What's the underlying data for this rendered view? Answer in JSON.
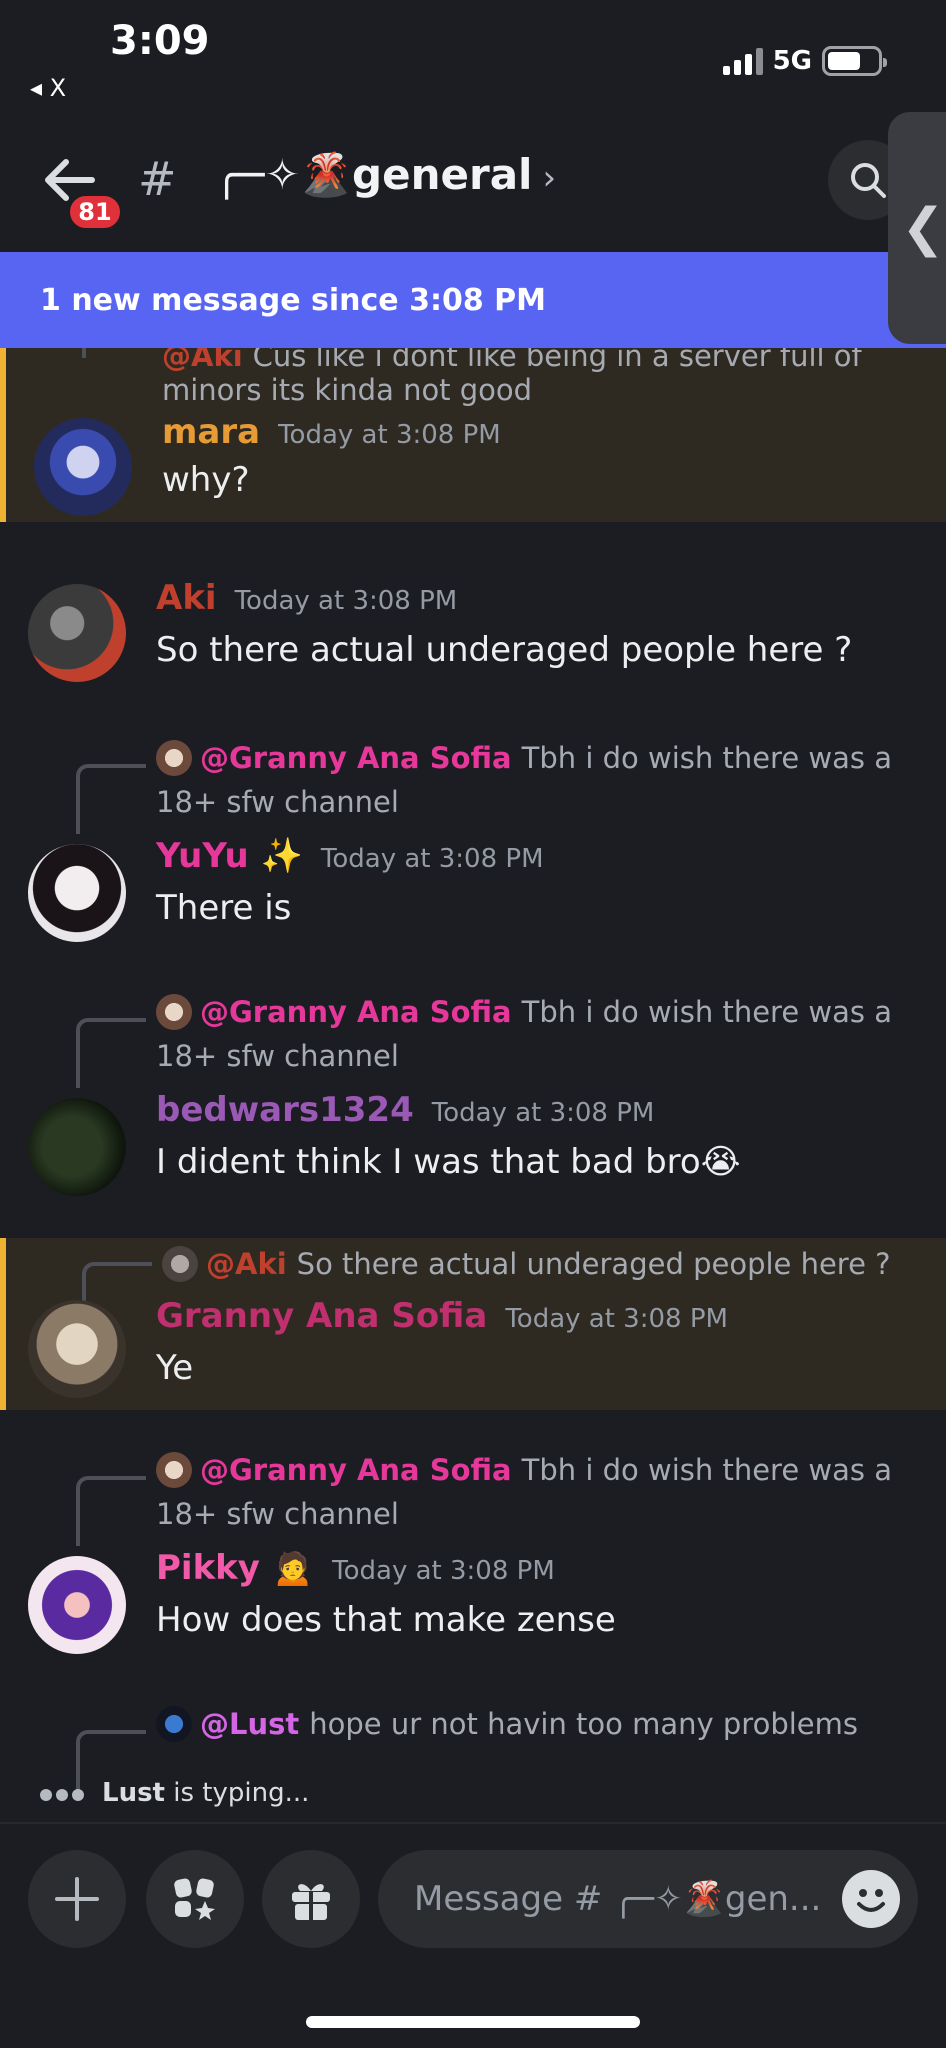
{
  "status": {
    "time": "3:09",
    "back_app": "◂ X",
    "network": "5G"
  },
  "header": {
    "unread_badge": "81",
    "hash": "#",
    "channel_name": "╭─✧🌋general",
    "chevron": "›",
    "side_tab_glyph": "❮"
  },
  "banner": {
    "text": "1 new message since 3:08 PM"
  },
  "messages": [
    {
      "reply_author": "@Aki",
      "reply_text": "Cus like i dont like being in a server full of",
      "reply_text_2": "minors its kinda not good",
      "author": "mara",
      "time": "Today at 3:08 PM",
      "text": "why?",
      "author_color": "#e69b35"
    },
    {
      "author": "Aki",
      "time": "Today at 3:08 PM",
      "text": "So there actual underaged people here ?",
      "author_color": "#c0402e"
    },
    {
      "reply_author": "@Granny Ana Sofia",
      "reply_text": "Tbh i do wish there was a",
      "reply_text_2": "18+ sfw channel",
      "author": "YuYu",
      "author_emoji": "✨",
      "time": "Today at 3:08 PM",
      "text": "There is",
      "author_color": "#e6389a"
    },
    {
      "reply_author": "@Granny Ana Sofia",
      "reply_text": "Tbh i do wish there was a",
      "reply_text_2": "18+ sfw channel",
      "author": "bedwars1324",
      "time": "Today at 3:08 PM",
      "text": "I dident think I was that bad bro😭",
      "author_color": "#9b59b6"
    },
    {
      "reply_author": "@Aki",
      "reply_text": "So there actual underaged people here ?",
      "author": "Granny Ana Sofia",
      "time": "Today at 3:08 PM",
      "text": "Ye",
      "author_color": "#c0306e"
    },
    {
      "reply_author": "@Granny Ana Sofia",
      "reply_text": "Tbh i do wish there was a",
      "reply_text_2": "18+ sfw channel",
      "author": "Pikky",
      "author_emoji": "🙍",
      "time": "Today at 3:08 PM",
      "text": "How does that make zense",
      "author_color": "#f05aa8"
    },
    {
      "reply_author": "@Lust",
      "reply_text": "hope ur not havin too many problems"
    }
  ],
  "typing": {
    "user": "Lust",
    "suffix": "is typing..."
  },
  "composer": {
    "placeholder": "Message # ╭─✧🌋gen..."
  },
  "colors": {
    "accent": "#5865f2",
    "highlight_bar": "#f0b232",
    "badge": "#e0303a",
    "mention_pink": "#e6389a",
    "mention_lust": "#d466e6"
  }
}
